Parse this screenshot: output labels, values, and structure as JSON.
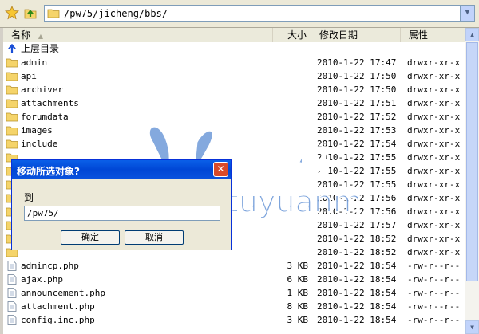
{
  "toolbar": {
    "path": "/pw75/jicheng/bbs/",
    "icons": {
      "favorite": "star-icon",
      "up": "up-folder-icon",
      "folder": "folder-icon"
    }
  },
  "columns": {
    "name": "名称",
    "size": "大小",
    "date": "修改日期",
    "attr": "属性"
  },
  "up_row": {
    "label": "上层目录"
  },
  "rows": [
    {
      "name": "admin",
      "size": "",
      "date": "2010-1-22 17:47",
      "attr": "drwxr-xr-x",
      "type": "folder"
    },
    {
      "name": "api",
      "size": "",
      "date": "2010-1-22 17:50",
      "attr": "drwxr-xr-x",
      "type": "folder"
    },
    {
      "name": "archiver",
      "size": "",
      "date": "2010-1-22 17:50",
      "attr": "drwxr-xr-x",
      "type": "folder"
    },
    {
      "name": "attachments",
      "size": "",
      "date": "2010-1-22 17:51",
      "attr": "drwxr-xr-x",
      "type": "folder"
    },
    {
      "name": "forumdata",
      "size": "",
      "date": "2010-1-22 17:52",
      "attr": "drwxr-xr-x",
      "type": "folder"
    },
    {
      "name": "images",
      "size": "",
      "date": "2010-1-22 17:53",
      "attr": "drwxr-xr-x",
      "type": "folder"
    },
    {
      "name": "include",
      "size": "",
      "date": "2010-1-22 17:54",
      "attr": "drwxr-xr-x",
      "type": "folder"
    },
    {
      "name": "",
      "size": "",
      "date": "2010-1-22 17:55",
      "attr": "drwxr-xr-x",
      "type": "folder"
    },
    {
      "name": "",
      "size": "",
      "date": "2010-1-22 17:55",
      "attr": "drwxr-xr-x",
      "type": "folder"
    },
    {
      "name": "",
      "size": "",
      "date": "2010-1-22 17:55",
      "attr": "drwxr-xr-x",
      "type": "folder"
    },
    {
      "name": "",
      "size": "",
      "date": "2010-1-22 17:56",
      "attr": "drwxr-xr-x",
      "type": "folder"
    },
    {
      "name": "",
      "size": "",
      "date": "2010-1-22 17:56",
      "attr": "drwxr-xr-x",
      "type": "folder"
    },
    {
      "name": "",
      "size": "",
      "date": "2010-1-22 17:57",
      "attr": "drwxr-xr-x",
      "type": "folder"
    },
    {
      "name": "",
      "size": "",
      "date": "2010-1-22 18:52",
      "attr": "drwxr-xr-x",
      "type": "folder"
    },
    {
      "name": "",
      "size": "",
      "date": "2010-1-22 18:52",
      "attr": "drwxr-xr-x",
      "type": "folder"
    },
    {
      "name": "admincp.php",
      "size": "3 KB",
      "date": "2010-1-22 18:54",
      "attr": "-rw-r--r--",
      "type": "file"
    },
    {
      "name": "ajax.php",
      "size": "6 KB",
      "date": "2010-1-22 18:54",
      "attr": "-rw-r--r--",
      "type": "file"
    },
    {
      "name": "announcement.php",
      "size": "1 KB",
      "date": "2010-1-22 18:54",
      "attr": "-rw-r--r--",
      "type": "file"
    },
    {
      "name": "attachment.php",
      "size": "8 KB",
      "date": "2010-1-22 18:54",
      "attr": "-rw-r--r--",
      "type": "file"
    },
    {
      "name": "config.inc.php",
      "size": "3 KB",
      "date": "2010-1-22 18:54",
      "attr": "-rw-r--r--",
      "type": "file"
    }
  ],
  "dialog": {
    "title": "移动所选对象?",
    "label": "到",
    "input_value": "/pw75/",
    "ok": "确定",
    "cancel": "取消",
    "close": "✕"
  },
  "watermark": {
    "cn": "兔源码",
    "en": "tuyuanma"
  }
}
